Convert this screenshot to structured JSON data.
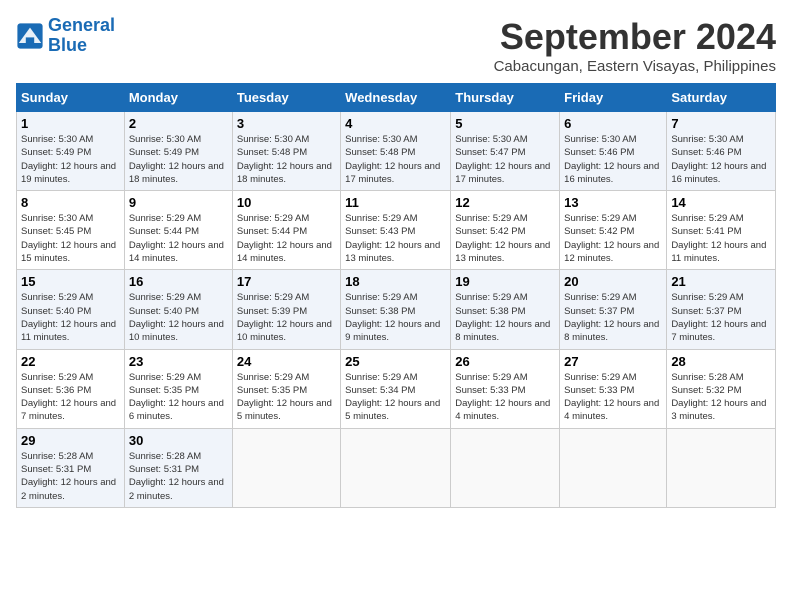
{
  "logo": {
    "line1": "General",
    "line2": "Blue"
  },
  "header": {
    "month": "September 2024",
    "location": "Cabacungan, Eastern Visayas, Philippines"
  },
  "weekdays": [
    "Sunday",
    "Monday",
    "Tuesday",
    "Wednesday",
    "Thursday",
    "Friday",
    "Saturday"
  ],
  "weeks": [
    [
      {
        "day": "1",
        "sunrise": "Sunrise: 5:30 AM",
        "sunset": "Sunset: 5:49 PM",
        "daylight": "Daylight: 12 hours and 19 minutes."
      },
      {
        "day": "2",
        "sunrise": "Sunrise: 5:30 AM",
        "sunset": "Sunset: 5:49 PM",
        "daylight": "Daylight: 12 hours and 18 minutes."
      },
      {
        "day": "3",
        "sunrise": "Sunrise: 5:30 AM",
        "sunset": "Sunset: 5:48 PM",
        "daylight": "Daylight: 12 hours and 18 minutes."
      },
      {
        "day": "4",
        "sunrise": "Sunrise: 5:30 AM",
        "sunset": "Sunset: 5:48 PM",
        "daylight": "Daylight: 12 hours and 17 minutes."
      },
      {
        "day": "5",
        "sunrise": "Sunrise: 5:30 AM",
        "sunset": "Sunset: 5:47 PM",
        "daylight": "Daylight: 12 hours and 17 minutes."
      },
      {
        "day": "6",
        "sunrise": "Sunrise: 5:30 AM",
        "sunset": "Sunset: 5:46 PM",
        "daylight": "Daylight: 12 hours and 16 minutes."
      },
      {
        "day": "7",
        "sunrise": "Sunrise: 5:30 AM",
        "sunset": "Sunset: 5:46 PM",
        "daylight": "Daylight: 12 hours and 16 minutes."
      }
    ],
    [
      {
        "day": "8",
        "sunrise": "Sunrise: 5:30 AM",
        "sunset": "Sunset: 5:45 PM",
        "daylight": "Daylight: 12 hours and 15 minutes."
      },
      {
        "day": "9",
        "sunrise": "Sunrise: 5:29 AM",
        "sunset": "Sunset: 5:44 PM",
        "daylight": "Daylight: 12 hours and 14 minutes."
      },
      {
        "day": "10",
        "sunrise": "Sunrise: 5:29 AM",
        "sunset": "Sunset: 5:44 PM",
        "daylight": "Daylight: 12 hours and 14 minutes."
      },
      {
        "day": "11",
        "sunrise": "Sunrise: 5:29 AM",
        "sunset": "Sunset: 5:43 PM",
        "daylight": "Daylight: 12 hours and 13 minutes."
      },
      {
        "day": "12",
        "sunrise": "Sunrise: 5:29 AM",
        "sunset": "Sunset: 5:42 PM",
        "daylight": "Daylight: 12 hours and 13 minutes."
      },
      {
        "day": "13",
        "sunrise": "Sunrise: 5:29 AM",
        "sunset": "Sunset: 5:42 PM",
        "daylight": "Daylight: 12 hours and 12 minutes."
      },
      {
        "day": "14",
        "sunrise": "Sunrise: 5:29 AM",
        "sunset": "Sunset: 5:41 PM",
        "daylight": "Daylight: 12 hours and 11 minutes."
      }
    ],
    [
      {
        "day": "15",
        "sunrise": "Sunrise: 5:29 AM",
        "sunset": "Sunset: 5:40 PM",
        "daylight": "Daylight: 12 hours and 11 minutes."
      },
      {
        "day": "16",
        "sunrise": "Sunrise: 5:29 AM",
        "sunset": "Sunset: 5:40 PM",
        "daylight": "Daylight: 12 hours and 10 minutes."
      },
      {
        "day": "17",
        "sunrise": "Sunrise: 5:29 AM",
        "sunset": "Sunset: 5:39 PM",
        "daylight": "Daylight: 12 hours and 10 minutes."
      },
      {
        "day": "18",
        "sunrise": "Sunrise: 5:29 AM",
        "sunset": "Sunset: 5:38 PM",
        "daylight": "Daylight: 12 hours and 9 minutes."
      },
      {
        "day": "19",
        "sunrise": "Sunrise: 5:29 AM",
        "sunset": "Sunset: 5:38 PM",
        "daylight": "Daylight: 12 hours and 8 minutes."
      },
      {
        "day": "20",
        "sunrise": "Sunrise: 5:29 AM",
        "sunset": "Sunset: 5:37 PM",
        "daylight": "Daylight: 12 hours and 8 minutes."
      },
      {
        "day": "21",
        "sunrise": "Sunrise: 5:29 AM",
        "sunset": "Sunset: 5:37 PM",
        "daylight": "Daylight: 12 hours and 7 minutes."
      }
    ],
    [
      {
        "day": "22",
        "sunrise": "Sunrise: 5:29 AM",
        "sunset": "Sunset: 5:36 PM",
        "daylight": "Daylight: 12 hours and 7 minutes."
      },
      {
        "day": "23",
        "sunrise": "Sunrise: 5:29 AM",
        "sunset": "Sunset: 5:35 PM",
        "daylight": "Daylight: 12 hours and 6 minutes."
      },
      {
        "day": "24",
        "sunrise": "Sunrise: 5:29 AM",
        "sunset": "Sunset: 5:35 PM",
        "daylight": "Daylight: 12 hours and 5 minutes."
      },
      {
        "day": "25",
        "sunrise": "Sunrise: 5:29 AM",
        "sunset": "Sunset: 5:34 PM",
        "daylight": "Daylight: 12 hours and 5 minutes."
      },
      {
        "day": "26",
        "sunrise": "Sunrise: 5:29 AM",
        "sunset": "Sunset: 5:33 PM",
        "daylight": "Daylight: 12 hours and 4 minutes."
      },
      {
        "day": "27",
        "sunrise": "Sunrise: 5:29 AM",
        "sunset": "Sunset: 5:33 PM",
        "daylight": "Daylight: 12 hours and 4 minutes."
      },
      {
        "day": "28",
        "sunrise": "Sunrise: 5:28 AM",
        "sunset": "Sunset: 5:32 PM",
        "daylight": "Daylight: 12 hours and 3 minutes."
      }
    ],
    [
      {
        "day": "29",
        "sunrise": "Sunrise: 5:28 AM",
        "sunset": "Sunset: 5:31 PM",
        "daylight": "Daylight: 12 hours and 2 minutes."
      },
      {
        "day": "30",
        "sunrise": "Sunrise: 5:28 AM",
        "sunset": "Sunset: 5:31 PM",
        "daylight": "Daylight: 12 hours and 2 minutes."
      },
      null,
      null,
      null,
      null,
      null
    ]
  ]
}
